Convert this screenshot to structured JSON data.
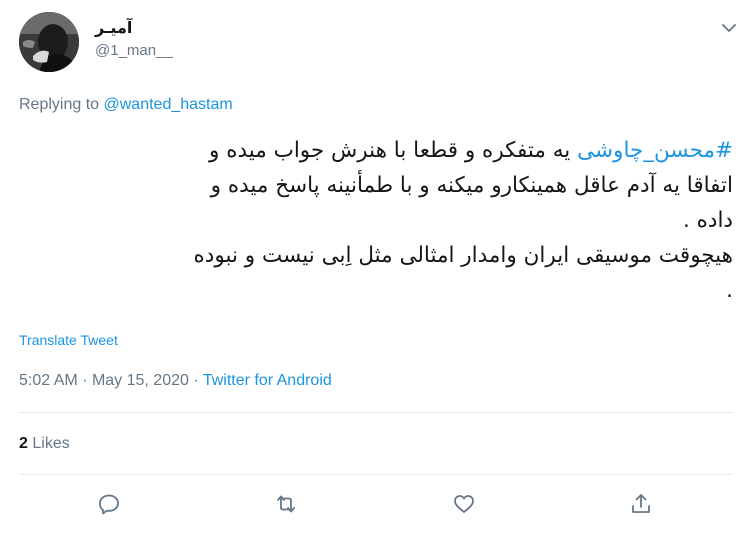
{
  "user": {
    "display_name": "آمیـر",
    "handle": "@1_man__",
    "avatar_icon": "profile-photo"
  },
  "reply": {
    "prefix": "Replying to",
    "target": "@wanted_hastam"
  },
  "tweet": {
    "hashtag": "#محسن_چاوشی",
    "line1_rest": " یه متفکره و قطعا با هنرش جواب میده و",
    "line2": "اتفاقا یه آدم عاقل همینکارو میکنه و با طمأنینه پاسخ میده و",
    "line3": "داده .",
    "line4": "هیچوقت موسیقی ایران وامدار امثالی مثل اِبی نیست و نبوده",
    "line5": "."
  },
  "translate_label": "Translate Tweet",
  "meta": {
    "time": "5:02 AM",
    "date": "May 15, 2020",
    "separator": "·",
    "source": "Twitter for Android"
  },
  "stats": {
    "likes_count": "2",
    "likes_label": "Likes"
  },
  "actions": {
    "reply_icon": "reply-icon",
    "retweet_icon": "retweet-icon",
    "like_icon": "heart-icon",
    "share_icon": "share-icon"
  },
  "colors": {
    "link": "#1b95e0",
    "secondary_text": "#657786",
    "primary_text": "#14171a",
    "divider": "#e6ecf0"
  }
}
